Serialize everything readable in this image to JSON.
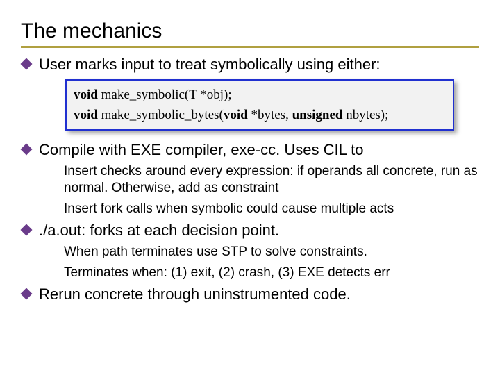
{
  "title": "The mechanics",
  "bullets": {
    "b1": {
      "text": "User marks input to treat symbolically using either:"
    },
    "code": {
      "sig1_kw1": "void",
      "sig1_rest": " make_symbolic(T *obj);",
      "sig2_kw1": "void",
      "sig2_mid": " make_symbolic_bytes(",
      "sig2_kw2": "void",
      "sig2_mid2": " *bytes, ",
      "sig2_kw3": "unsigned",
      "sig2_end": " nbytes);"
    },
    "b2": {
      "text": "Compile with EXE compiler, exe-cc.  Uses CIL to",
      "sub1": "Insert checks around every expression: if operands all concrete, run as normal.  Otherwise, add as constraint",
      "sub2": "Insert fork calls when symbolic could cause multiple acts"
    },
    "b3": {
      "text": "./a.out: forks at each decision point.",
      "sub1": "When path terminates use STP to solve constraints.",
      "sub2": "Terminates when: (1) exit, (2) crash, (3) EXE detects err"
    },
    "b4": {
      "text": "Rerun concrete through uninstrumented code."
    }
  }
}
